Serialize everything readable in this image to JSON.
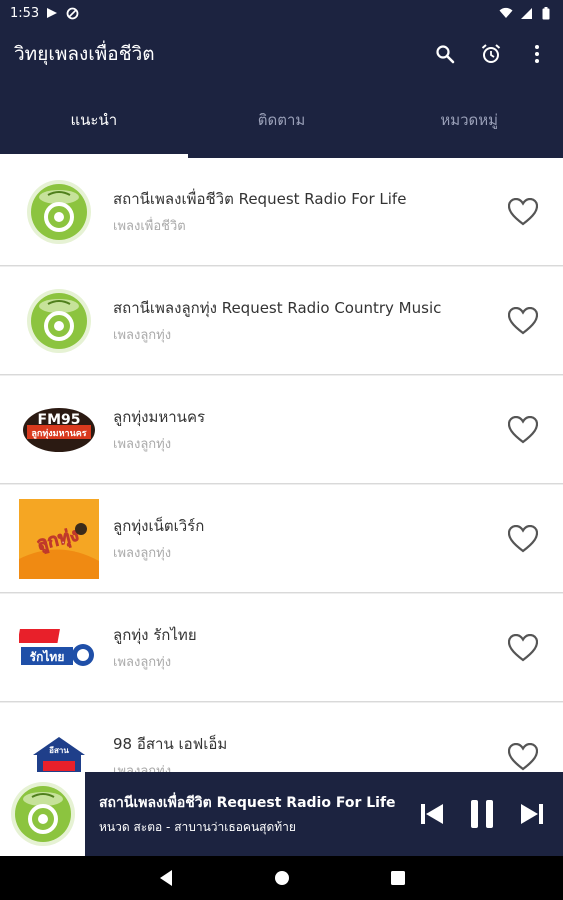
{
  "status_bar": {
    "time": "1:53"
  },
  "app_bar": {
    "title": "วิทยุเพลงเพื่อชีวิต"
  },
  "tabs": [
    {
      "label": "แนะนำ",
      "active": true
    },
    {
      "label": "ติดตาม",
      "active": false
    },
    {
      "label": "หมวดหมู่",
      "active": false
    }
  ],
  "stations": [
    {
      "name": "สถานีเพลงเพื่อชีวิต Request Radio For Life",
      "category": "เพลงเพื่อชีวิต",
      "logo": "request-radio-logo"
    },
    {
      "name": "สถานีเพลงลูกทุ่ง Request Radio Country Music",
      "category": "เพลงลูกทุ่ง",
      "logo": "request-radio-logo"
    },
    {
      "name": "ลูกทุ่งมหานคร",
      "category": "เพลงลูกทุ่ง",
      "logo": "fm95-logo",
      "logo_text": "FM95",
      "logo_subtext": "ลูกทุ่งมหานคร"
    },
    {
      "name": "ลูกทุ่งเน็ตเวิร์ก",
      "category": "เพลงลูกทุ่ง",
      "logo": "luktung-network-logo",
      "logo_text": "ลูกทุ่ง"
    },
    {
      "name": "ลูกทุ่ง รักไทย",
      "category": "เพลงลูกทุ่ง",
      "logo": "raktai-logo",
      "logo_text": "รักไทย"
    },
    {
      "name": "98 อีสาน เอฟเอ็ม",
      "category": "เพลงลูกทุ่ง",
      "logo": "isan-fm-logo",
      "logo_text": "อีสาน"
    }
  ],
  "player": {
    "title": "สถานีเพลงเพื่อชีวิต Request Radio For Life",
    "subtitle": "หนวด สะตอ - สาบานว่าเธอคนสุดท้าย"
  },
  "colors": {
    "primary": "#1c2340",
    "list_bg": "#eeeeee",
    "heart": "#555555",
    "logo_green": "#8cc43f"
  }
}
